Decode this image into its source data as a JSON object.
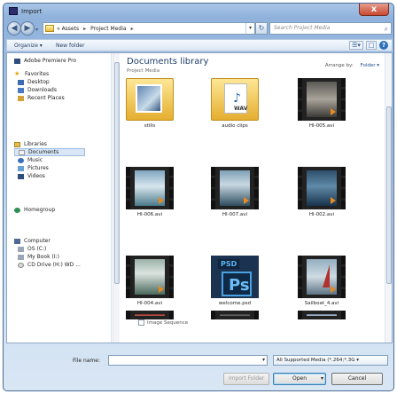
{
  "window": {
    "title": "Import",
    "close": "x"
  },
  "nav": {
    "back": "◀",
    "forward": "▶",
    "history": "▾",
    "breadcrumb": [
      "« Assets",
      "▸",
      "Project Media",
      "▸"
    ],
    "address_dropdown": "▾",
    "refresh": "↻",
    "search_placeholder": "Search Project Media",
    "search_icon": "⌕"
  },
  "commandbar": {
    "organize": "Organize ▾",
    "new_folder": "New folder",
    "views": "☰▾",
    "preview": "□",
    "help": "?"
  },
  "sidebar": {
    "favorites": [
      {
        "label": "Adobe Premiere Pro",
        "icon": "premiere-icon"
      },
      {
        "label": "Favorites",
        "icon": "star-icon"
      },
      {
        "label": "Desktop",
        "icon": "desktop-icon"
      },
      {
        "label": "Downloads",
        "icon": "downloads-icon"
      },
      {
        "label": "Recent Places",
        "icon": "recent-places-icon"
      }
    ],
    "libraries": [
      {
        "label": "Libraries",
        "icon": "libraries-icon"
      },
      {
        "label": "Documents",
        "icon": "documents-icon"
      },
      {
        "label": "Music",
        "icon": "music-icon"
      },
      {
        "label": "Pictures",
        "icon": "pictures-icon"
      },
      {
        "label": "Videos",
        "icon": "videos-icon"
      }
    ],
    "homegroup": {
      "label": "Homegroup",
      "icon": "homegroup-icon"
    },
    "computer": [
      {
        "label": "Computer",
        "icon": "computer-icon"
      },
      {
        "label": "OS (C:)",
        "icon": "drive-icon"
      },
      {
        "label": "My Book (I:)",
        "icon": "drive-icon"
      },
      {
        "label": "CD Drive (H:) WD ...",
        "icon": "dvd-icon"
      }
    ]
  },
  "library": {
    "title": "Documents library",
    "subtitle": "Project Media",
    "arrange_label": "Arrange by:",
    "arrange_value": "Folder ▾"
  },
  "files": [
    {
      "name": "stills",
      "kind": "folder-photo"
    },
    {
      "name": "audio clips",
      "kind": "folder-audio"
    },
    {
      "name": "HI-005.avi",
      "kind": "video"
    },
    {
      "name": "HI-006.avi",
      "kind": "video"
    },
    {
      "name": "HI-007.avi",
      "kind": "video"
    },
    {
      "name": "HI-002.avi",
      "kind": "video"
    },
    {
      "name": "HI-004.avi",
      "kind": "video"
    },
    {
      "name": "welcome.psd",
      "kind": "psd"
    },
    {
      "name": "Sailboat_4.avi",
      "kind": "video"
    }
  ],
  "image_sequence": "Image Sequence",
  "footer": {
    "file_name_label": "File name:",
    "file_type": "All Supported Media (*.264;*.3G ▾",
    "import_folder": "Import Folder",
    "open": "Open",
    "open_arrow": "▾",
    "cancel": "Cancel"
  },
  "colors": {
    "window_frame": "#8fb1db",
    "accent": "#1f3f6c",
    "close": "#c84a33"
  }
}
